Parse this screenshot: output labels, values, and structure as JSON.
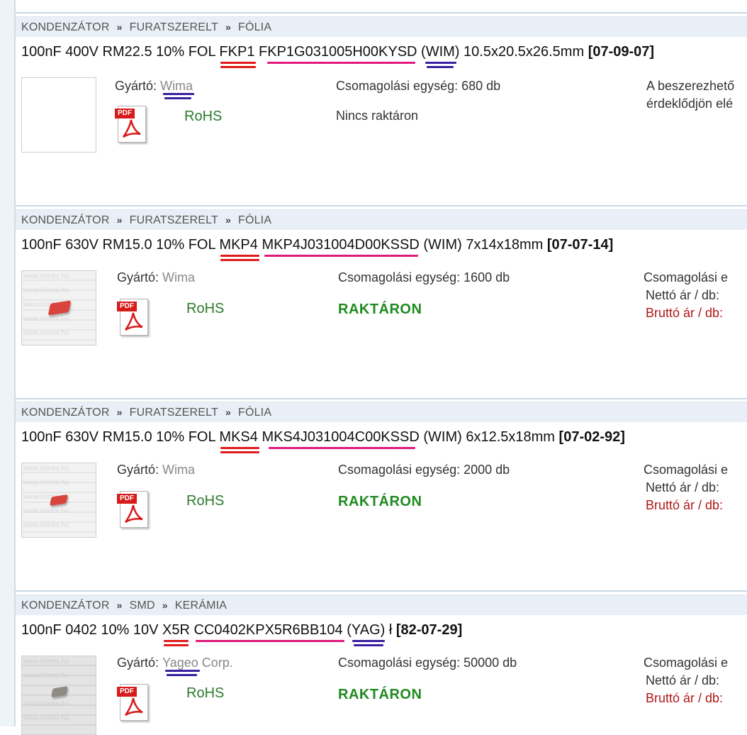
{
  "products": [
    {
      "breadcrumb": [
        "KONDENZÁTOR",
        "FURATSZERELT",
        "FÓLIA"
      ],
      "title": {
        "prefix": "100nF 400V RM22.5 10% FOL ",
        "series": "FKP1",
        "part_number": "FKP1G031005H00KYSD",
        "maker_code": "(WIM)",
        "dims": " 10.5x20.5x26.5mm ",
        "code": "[07-09-07]"
      },
      "manufacturer_label": "Gyártó:",
      "manufacturer": "Wima",
      "rohs": "RoHS",
      "packaging": "Csomagolási egység: 680 db",
      "stock": "Nincs raktáron",
      "right_lines": [
        "A beszerezhető",
        "érdeklődjön elé"
      ]
    },
    {
      "breadcrumb": [
        "KONDENZÁTOR",
        "FURATSZERELT",
        "FÓLIA"
      ],
      "title": {
        "prefix": "100nF 630V RM15.0 10% FOL ",
        "series": "MKP4",
        "part_number": "MKP4J031004D00KSSD",
        "maker_code": "(WIM)",
        "dims": " 7x14x18mm ",
        "code": "[07-07-14]"
      },
      "manufacturer_label": "Gyártó:",
      "manufacturer": "Wima",
      "rohs": "RoHS",
      "packaging": "Csomagolási egység: 1600 db",
      "stock": "RAKTÁRON",
      "right_lines": [
        "Csomagolási e",
        "Nettó ár / db:",
        "Bruttó ár / db:"
      ]
    },
    {
      "breadcrumb": [
        "KONDENZÁTOR",
        "FURATSZERELT",
        "FÓLIA"
      ],
      "title": {
        "prefix": "100nF 630V RM15.0 10% FOL ",
        "series": "MKS4",
        "part_number": "MKS4J031004C00KSSD",
        "maker_code": "(WIM)",
        "dims": " 6x12.5x18mm ",
        "code": "[07-02-92]"
      },
      "manufacturer_label": "Gyártó:",
      "manufacturer": "Wima",
      "rohs": "RoHS",
      "packaging": "Csomagolási egység: 2000 db",
      "stock": "RAKTÁRON",
      "right_lines": [
        "Csomagolási e",
        "Nettó ár / db:",
        "Bruttó ár / db:"
      ]
    },
    {
      "breadcrumb": [
        "KONDENZÁTOR",
        "SMD",
        "KERÁMIA"
      ],
      "title": {
        "prefix": "100nF 0402 10% 10V ",
        "series": "X5R",
        "part_number": "CC0402KPX5R6BB104",
        "maker_code": "(YAG)",
        "dims": " ł ",
        "code": "[82-07-29]"
      },
      "manufacturer_label": "Gyártó:",
      "manufacturer": "Yageo",
      "manufacturer_suffix": " Corp.",
      "rohs": "RoHS",
      "packaging": "Csomagolási egység: 50000 db",
      "stock": "RAKTÁRON",
      "right_lines": [
        "Csomagolási e",
        "Nettó ár / db:",
        "Bruttó ár / db:"
      ]
    }
  ],
  "pdf_tag": "PDF",
  "watermark": "www.lomex.hu",
  "icons": [
    "pdf-icon",
    "chevron-right-icon"
  ],
  "colors": {
    "red_underline": "#e01a1a",
    "pink_underline": "#e0197d",
    "purple_underline": "#3a1fa0",
    "in_stock": "#1f8a1f",
    "brutto": "#b01818"
  }
}
